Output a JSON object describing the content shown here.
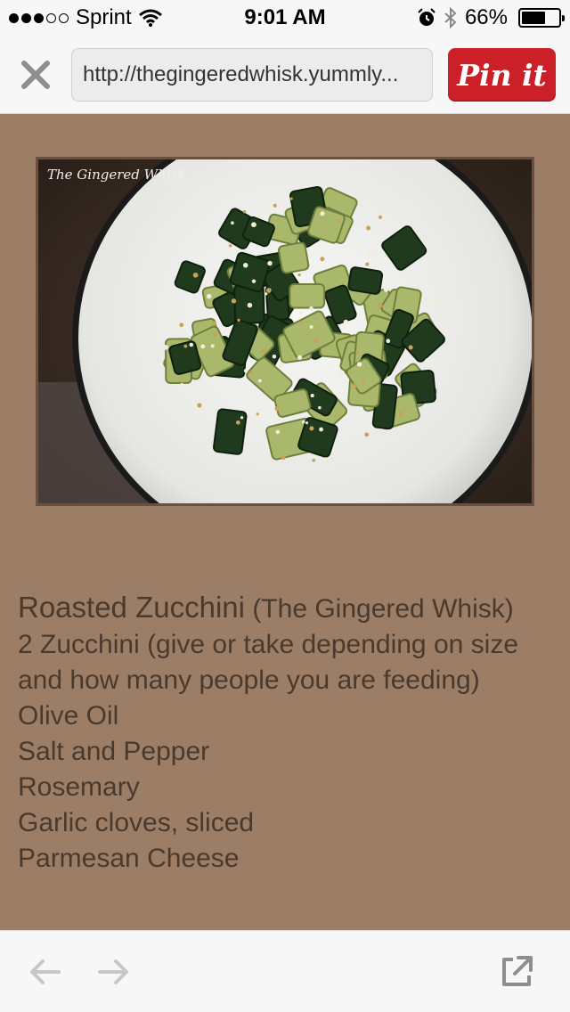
{
  "status_bar": {
    "carrier": "Sprint",
    "time": "9:01 AM",
    "battery_percent": "66%",
    "battery_level": 0.66,
    "signal_bars": 3,
    "icons": [
      "wifi-icon",
      "alarm-icon",
      "bluetooth-icon",
      "battery-icon"
    ]
  },
  "toolbar": {
    "url": "http://thegingeredwhisk.yummly...",
    "pin_label": "Pin it",
    "pin_color": "#cb2027"
  },
  "photo": {
    "watermark": "The Gingered Whisk"
  },
  "recipe": {
    "title": "Roasted Zucchini",
    "source": "(The Gingered Whisk)",
    "ingredients": [
      "2 Zucchini (give or take depending on size and how many people you are feeding)",
      "Olive Oil",
      "Salt and Pepper",
      "Rosemary",
      "Garlic cloves, sliced",
      "Parmesan Cheese"
    ]
  },
  "colors": {
    "content_background": "#9c7d65",
    "text": "#4a3a2e"
  }
}
